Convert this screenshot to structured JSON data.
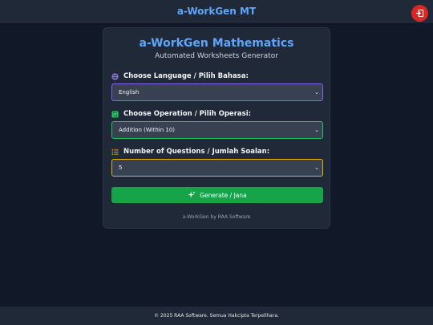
{
  "header": {
    "title": "a-WorkGen MT",
    "logout_icon": "logout-icon",
    "logout_color": "#dc2626"
  },
  "card": {
    "title": "a-WorkGen Mathematics",
    "subtitle": "Automated Worksheets Generator",
    "language": {
      "label": "Choose Language / Pilih Bahasa:",
      "icon": "globe-icon",
      "value": "English",
      "accent": "#8b5cf6"
    },
    "operation": {
      "label": "Choose Operation / Pilih Operasi:",
      "icon": "calculator-icon",
      "value": "Addition (Within 10)",
      "accent": "#22c55e"
    },
    "questions": {
      "label": "Number of Questions / Jumlah Soalan:",
      "icon": "list-icon",
      "value": "5",
      "accent": "#eab308"
    },
    "generate_button": {
      "label": "Generate / Jana",
      "icon": "sparkles-icon",
      "color": "#16a34a"
    },
    "credit": "a-WorkGen by RAA Software"
  },
  "footer": {
    "text": "© 2025 RAA Software. Semua Hakcipta Terpelihara."
  }
}
